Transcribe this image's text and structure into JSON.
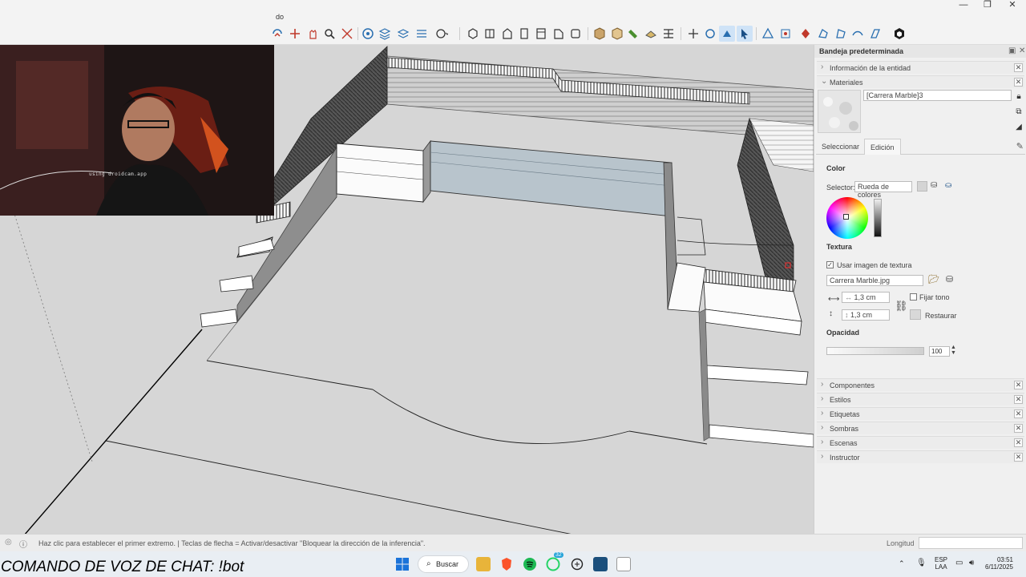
{
  "menu_fragment": "do",
  "window_controls": [
    "—",
    "❐",
    "✕"
  ],
  "webcam_caption": "using droidcam.app",
  "tray": {
    "title": "Bandeja predeterminada",
    "sections_top": [
      {
        "label": "Información de la entidad",
        "expanded": false
      },
      {
        "label": "Materiales",
        "expanded": true
      }
    ],
    "material_name": "[Carrera Marble]3",
    "tabs": [
      "Seleccionar",
      "Edición"
    ],
    "active_tab": "Edición",
    "color_heading": "Color",
    "selector_label": "Selector:",
    "selector_value": "Rueda de colores",
    "texture_heading": "Textura",
    "use_texture_label": "Usar imagen de textura",
    "use_texture_checked": true,
    "texture_file": "Carrera Marble.jpg",
    "width_value": "1,3 cm",
    "height_value": "1,3 cm",
    "fix_tone_label": "Fijar tono",
    "restore_label": "Restaurar",
    "opacity_heading": "Opacidad",
    "opacity_value": "100",
    "opacity_level": 1.0,
    "sections_bottom": [
      "Componentes",
      "Estilos",
      "Etiquetas",
      "Sombras",
      "Escenas",
      "Instructor"
    ]
  },
  "status": {
    "message": "Haz clic para establecer el primer extremo.  |  Teclas de flecha = Activar/desactivar \"Bloquear la dirección de la inferencia\".",
    "measure_label": "Longitud",
    "measure_value": ""
  },
  "taskbar": {
    "overlay_text": "COMANDO DE VOZ DE CHAT: !bot",
    "search_label": "Buscar",
    "whatsapp_badge": "32",
    "lang_top": "ESP",
    "lang_bottom": "LAA",
    "time": "03:51",
    "date": "6/11/2025"
  },
  "colors": {
    "viewport_bg": "#d6d6d6",
    "blue_panel": "#b8c4cc",
    "dark_wall": "#444444",
    "accent_cube": "#0b5a8f"
  }
}
